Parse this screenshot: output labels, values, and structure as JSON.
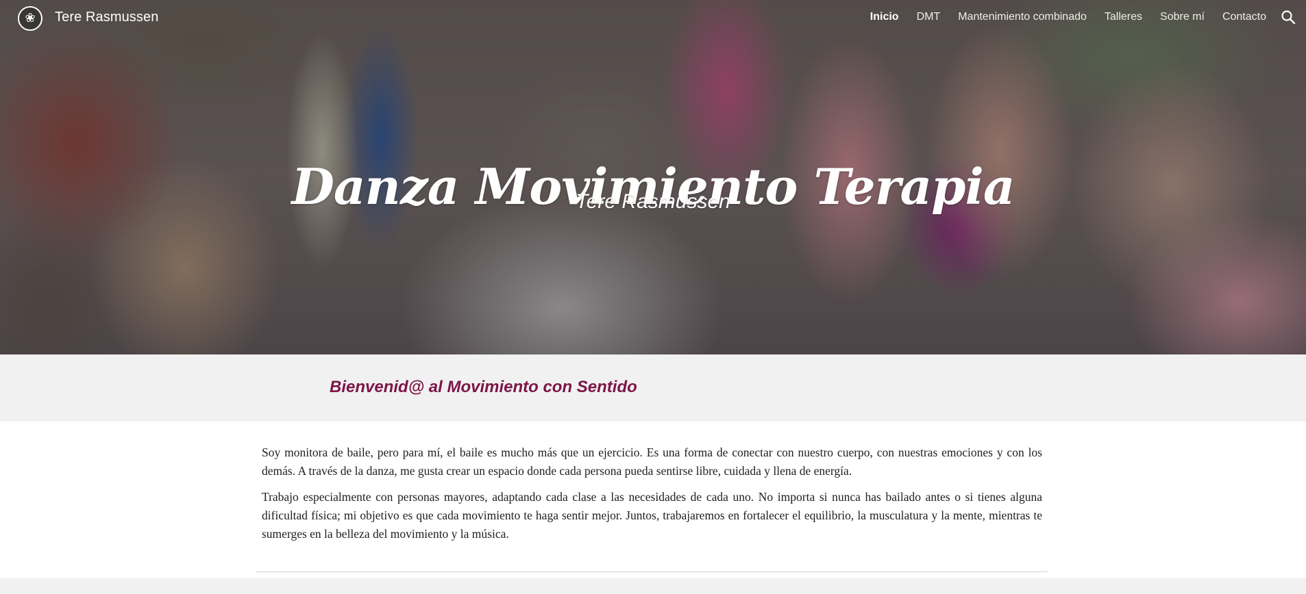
{
  "header": {
    "site_title": "Tere Rasmussen",
    "logo_icon": "lotus-logo-icon",
    "search_icon": "search-icon"
  },
  "nav": {
    "items": [
      {
        "label": "Inicio",
        "active": true
      },
      {
        "label": "DMT",
        "active": false
      },
      {
        "label": "Mantenimiento combinado",
        "active": false
      },
      {
        "label": "Talleres",
        "active": false
      },
      {
        "label": "Sobre mí",
        "active": false
      },
      {
        "label": "Contacto",
        "active": false
      }
    ]
  },
  "hero": {
    "title": "Danza Movimiento Terapia",
    "subtitle": "Tere Rasmussen"
  },
  "welcome": {
    "heading": "Bienvenid@ al Movimiento con Sentido"
  },
  "content": {
    "paragraphs": [
      "Soy monitora de baile, pero para mí, el baile es mucho más que un ejercicio. Es una forma de conectar con nuestro cuerpo, con nuestras emociones y con los demás. A través de la danza, me gusta crear un espacio donde cada persona pueda sentirse libre, cuidada y llena de energía.",
      "Trabajo especialmente con personas mayores, adaptando cada clase a las necesidades de cada uno. No importa si nunca has bailado antes o si tienes alguna dificultad física; mi objetivo es que cada movimiento te haga sentir mejor. Juntos, trabajaremos en fortalecer el equilibrio, la musculatura y la mente, mientras te sumerges en la belleza del movimiento y la música."
    ]
  },
  "colors": {
    "accent": "#7c1548",
    "band_background": "#f1f1f1",
    "body_text": "#212121"
  }
}
